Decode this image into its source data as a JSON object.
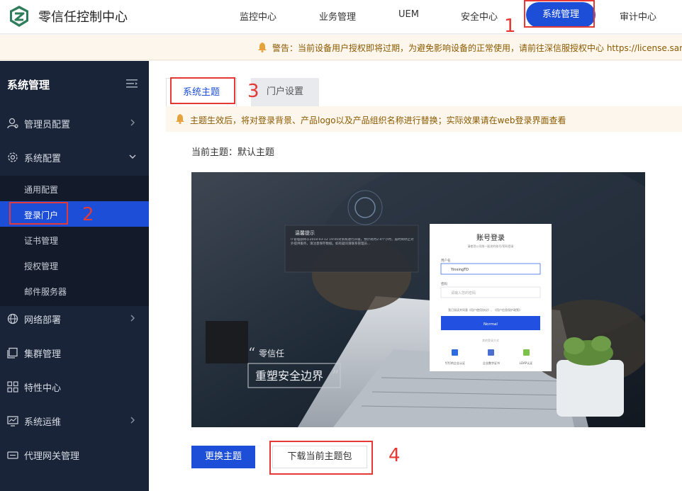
{
  "app": {
    "title": "零信任控制中心"
  },
  "topnav": {
    "items": [
      "监控中心",
      "业务管理",
      "UEM",
      "安全中心"
    ],
    "active": "系统管理",
    "last": "审计中心"
  },
  "warning": {
    "text": "警告：当前设备用户授权即将过期，为避免影响设备的正常使用，请前往深信服授权中心 https://license.sangfor.com"
  },
  "sidebar": {
    "header": "系统管理",
    "items": [
      {
        "label": "管理员配置",
        "icon": "user-gear-icon"
      },
      {
        "label": "系统配置",
        "icon": "gear-icon"
      },
      {
        "label": "网络部署",
        "icon": "globe-icon"
      },
      {
        "label": "集群管理",
        "icon": "cluster-icon"
      },
      {
        "label": "特性中心",
        "icon": "grid-icon"
      },
      {
        "label": "系统运维",
        "icon": "monitor-icon"
      },
      {
        "label": "代理网关管理",
        "icon": "gateway-icon"
      }
    ],
    "sub_items": [
      "通用配置",
      "登录门户",
      "证书管理",
      "授权管理",
      "邮件服务器"
    ]
  },
  "tabs": {
    "active": "系统主题",
    "other": "门户设置"
  },
  "tip": {
    "text": "主题生效后，将对登录背景、产品logo以及产品组织名称进行替换；实际效果请在web登录界面查看"
  },
  "current_theme": "当前主题：默认主题",
  "preview": {
    "notice_title": "温馨提示",
    "notice_body": "IT管理部将于2018-03-12 19:00对系统进行升级，预计耗时2-4个小时，届时将停止对外提供服务，请注意保存数据。如有疑问请联系管理员...",
    "brand_small": "零信任",
    "brand_big": "重塑安全边界",
    "login_title": "账号登录",
    "login_subtitle": "请使用公司统一配发的账号/密码登录",
    "username_label": "用户名",
    "username_value": "YinxingTD",
    "password_label": "密码",
    "password_placeholder": "请输入您的密码",
    "agree_text": "我已阅读并同意《用户使用协议》、《用户信息保护政策》",
    "login_button": "Normal",
    "other_methods": "其他登录方式",
    "methods": [
      "钉钉的企业认证",
      "企业数字证书",
      "LDAP认证"
    ]
  },
  "buttons": {
    "change_theme": "更换主题",
    "download_theme": "下载当前主题包"
  },
  "annotations": [
    "1",
    "2",
    "3",
    "4"
  ],
  "colors": {
    "accent": "#1d4ed8",
    "sidebar": "#1a2438",
    "annotation": "#e53935",
    "warning_bg": "#fdf6ec"
  }
}
